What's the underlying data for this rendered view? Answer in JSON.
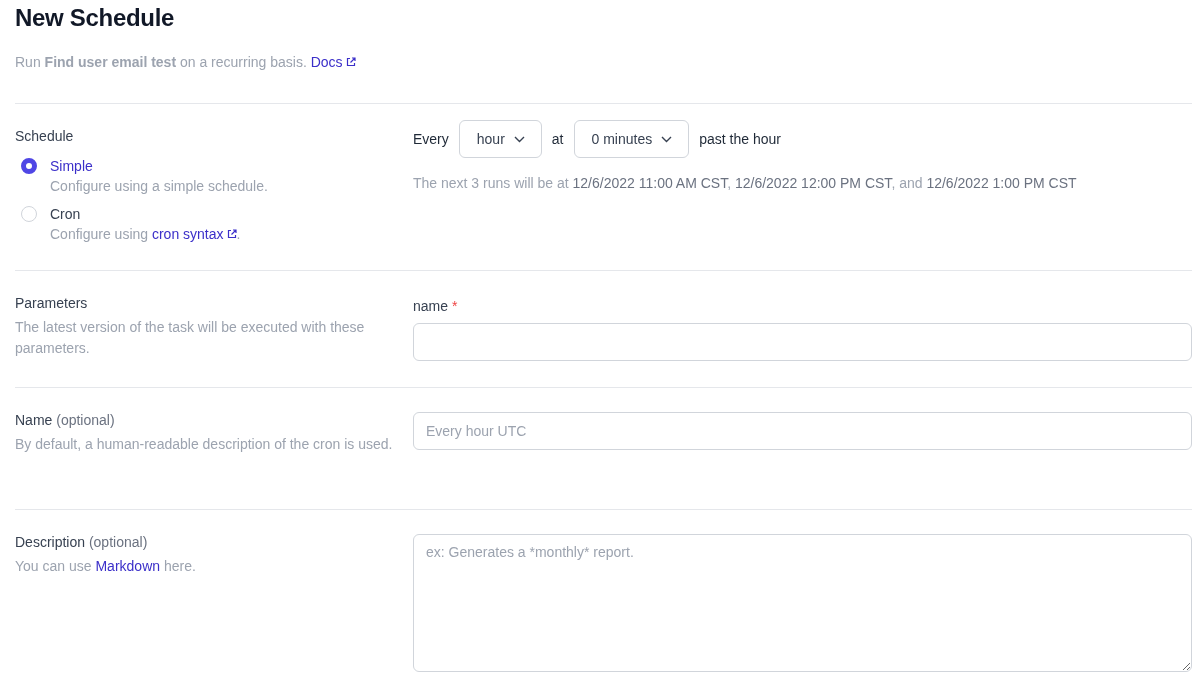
{
  "title": "New Schedule",
  "subtitle": {
    "text": "Run **Find user email test** on a recurring basis.",
    "link": "Docs",
    "external": true
  },
  "sections": [
    {
      "kind": "schedule",
      "label": "Schedule",
      "options": [
        {
          "label": "Simple",
          "selected": true,
          "description": {
            "before": "Configure using a simple schedule."
          }
        },
        {
          "label": "Cron",
          "selected": false,
          "description": {
            "before": "Configure using ",
            "link": "cron syntax",
            "external": true,
            "after": "."
          }
        }
      ],
      "builder": {
        "prefix": "Every",
        "unit": "hour",
        "joiner": "at",
        "minutes": "0 minutes",
        "suffix": "past the hour"
      },
      "next_runs": "The next 3 runs will be at **12/6/2022 11:00 AM CST**, **12/6/2022 12:00 PM CST**, and **12/6/2022 1:00 PM CST**"
    },
    {
      "kind": "params",
      "label": "Parameters",
      "help": {
        "before": "The latest version of the task will be executed with these parameters."
      },
      "field_label": "name",
      "required_mark": "*"
    },
    {
      "kind": "input",
      "label": "Name",
      "suffix": "(optional)",
      "help": {
        "before": "By default, a human-readable description of the cron is used."
      },
      "placeholder": "Every hour UTC"
    },
    {
      "kind": "textarea",
      "label": "Description",
      "suffix": "(optional)",
      "help": {
        "before": "You can use ",
        "link": "Markdown",
        "external": false,
        "after": " here."
      },
      "placeholder": "ex: Generates a *monthly* report."
    }
  ]
}
